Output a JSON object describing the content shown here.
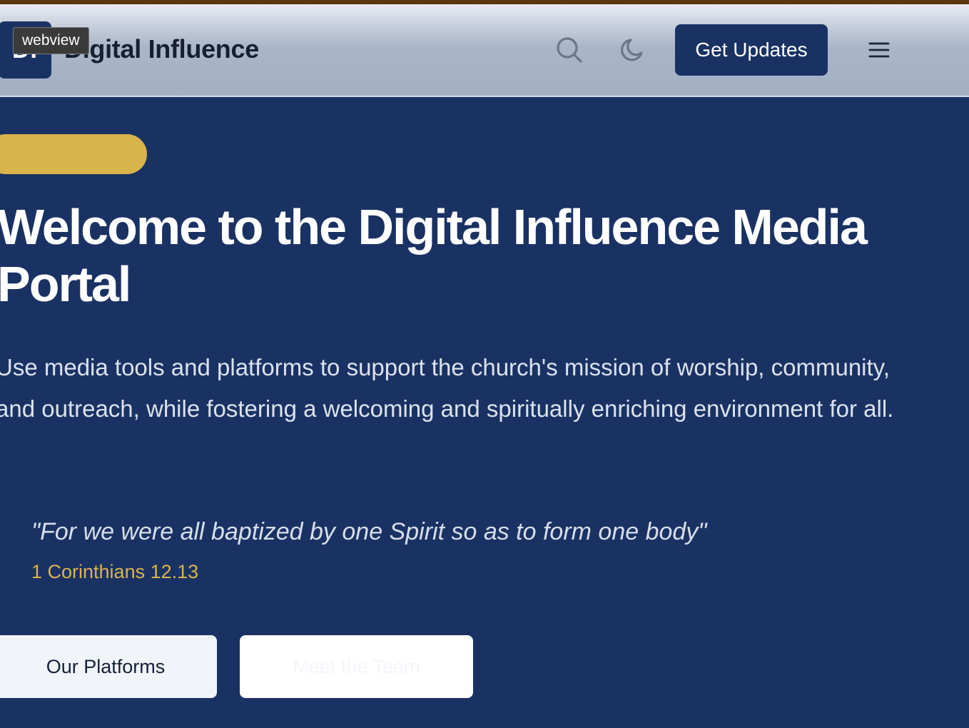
{
  "header": {
    "logo_initials": "DI",
    "brand_name": "Digital Influence",
    "tooltip": "webview",
    "search_icon": "search-icon",
    "theme_icon": "moon-icon",
    "updates_button": "Get Updates",
    "menu_icon": "hamburger-menu-icon"
  },
  "hero": {
    "title": "Welcome to the Digital Influence Media Portal",
    "description": "Use media tools and platforms to support the church's mission of worship, community, and outreach, while fostering a welcoming and spiritually enriching environment for all.",
    "quote": "\"For we were all baptized by one Spirit so as to form one body\"",
    "quote_reference": "1 Corinthians 12.13",
    "primary_button": "Our Platforms",
    "secondary_button": "Meet the Team"
  },
  "colors": {
    "navy": "#1a3263",
    "gold": "#d9b44a",
    "header_bg": "#a3b0c4",
    "top_strip": "#5a3510"
  }
}
